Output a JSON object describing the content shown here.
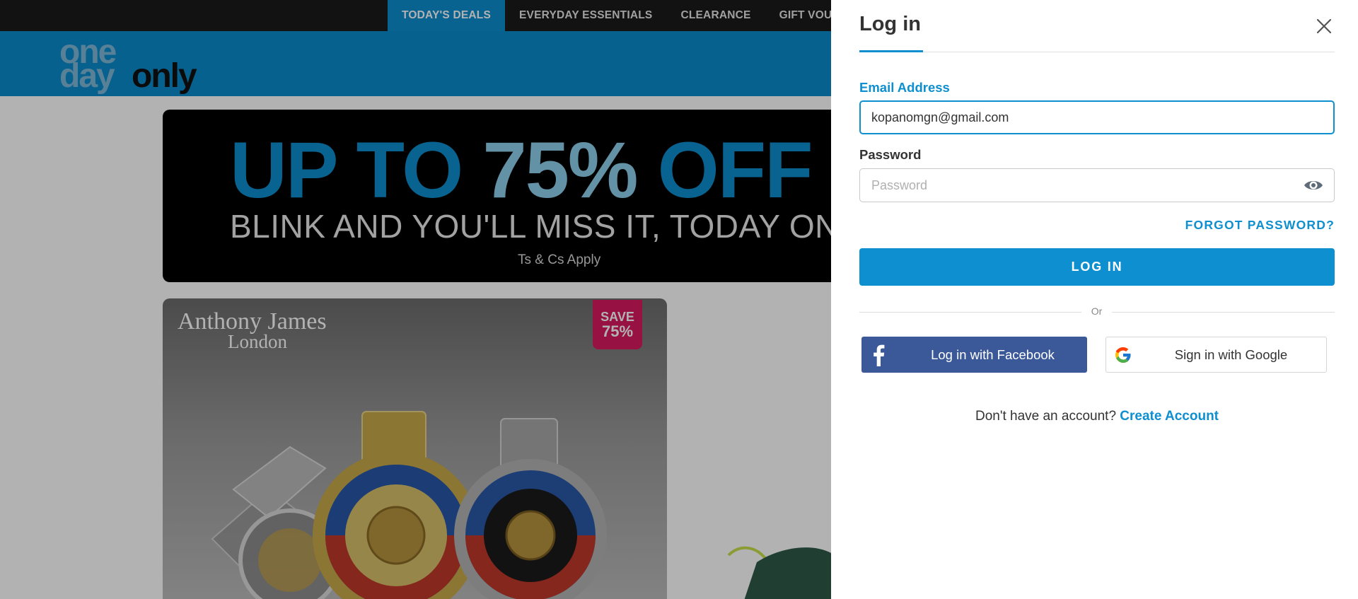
{
  "topnav": {
    "links": [
      {
        "label": "TODAY'S DEALS",
        "active": true
      },
      {
        "label": "EVERYDAY ESSENTIALS"
      },
      {
        "label": "CLEARANCE"
      },
      {
        "label": "GIFT VOU"
      }
    ]
  },
  "logo": {
    "part1": "one",
    "part2": "day",
    "part3": "only"
  },
  "banner": {
    "headline_start": "UP TO ",
    "headline_pct": "75%",
    "headline_end": " OFF",
    "subline": "BLINK AND YOU'LL MISS IT, TODAY ONLY",
    "terms": "Ts & Cs Apply"
  },
  "product": {
    "brand_line1": "Anthony James",
    "brand_line2": "London",
    "save_label": "SAVE",
    "save_value": "75%"
  },
  "login": {
    "title": "Log in",
    "email_label": "Email Address",
    "email_value": "kopanomgn@gmail.com",
    "password_label": "Password",
    "password_placeholder": "Password",
    "forgot_label": "FORGOT PASSWORD?",
    "login_button": "LOG IN",
    "or_text": "Or",
    "facebook_label": "Log in with Facebook",
    "google_label": "Sign in with Google",
    "no_account_text": "Don't have an account? ",
    "create_account_label": "Create Account"
  },
  "colors": {
    "accent": "#0e8fcf",
    "facebook": "#3b5998",
    "save_badge": "#d81b60",
    "topnav_bg": "#1b1b1b"
  },
  "icons": [
    "close-icon",
    "eye-icon",
    "facebook-icon",
    "google-icon"
  ]
}
